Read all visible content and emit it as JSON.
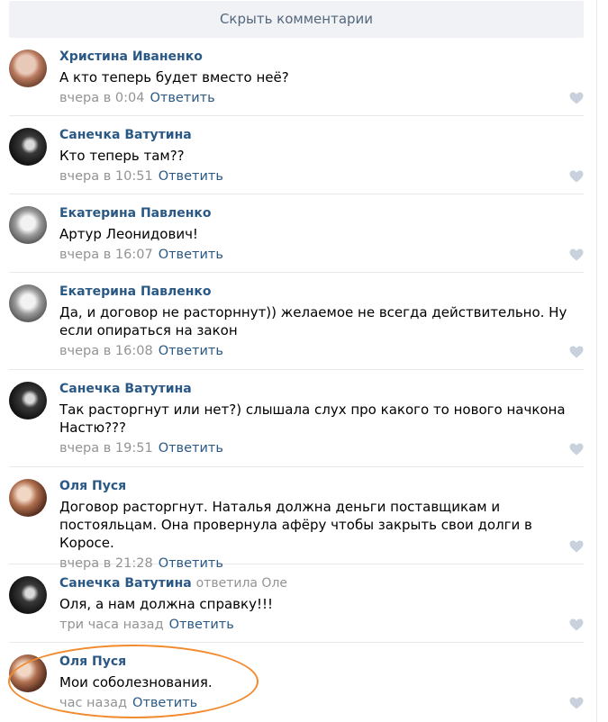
{
  "hide_comments_label": "Скрыть комментарии",
  "colors": {
    "link": "#2a5885",
    "meta": "#939393",
    "highlight": "#f28a2e",
    "button_bg": "#f0f2f5"
  },
  "comments": [
    {
      "author": "Христина Иваненко",
      "reply_to": "",
      "text": "А кто теперь будет вместо неё?",
      "time": "вчера в 0:04",
      "reply_label": "Ответить",
      "avatar_icon": "user-avatar-photo"
    },
    {
      "author": "Санечка Ватутина",
      "reply_to": "",
      "text": "Кто теперь там??",
      "time": "вчера в 10:51",
      "reply_label": "Ответить",
      "avatar_icon": "user-avatar-photo"
    },
    {
      "author": "Екатерина Павленко",
      "reply_to": "",
      "text": "Артур Леонидович!",
      "time": "вчера в 16:07",
      "reply_label": "Ответить",
      "avatar_icon": "user-avatar-photo"
    },
    {
      "author": "Екатерина Павленко",
      "reply_to": "",
      "text": "Да, и договор не расторннут)) желаемое не всегда действительно. Ну если опираться на закон",
      "time": "вчера в 16:08",
      "reply_label": "Ответить",
      "avatar_icon": "user-avatar-photo"
    },
    {
      "author": "Санечка Ватутина",
      "reply_to": "",
      "text": "Так расторгнут или нет?) слышала слух про какого то нового начкона Настю???",
      "time": "вчера в 19:51",
      "reply_label": "Ответить",
      "avatar_icon": "user-avatar-photo"
    },
    {
      "author": "Оля Пуся",
      "reply_to": "",
      "text": "Договор расторгнут. Наталья должна деньги поставщикам и постояльцам. Она провернула афёру чтобы закрыть свои долги в Коросе.",
      "time": "вчера в 21:28",
      "reply_label": "Ответить",
      "avatar_icon": "user-avatar-photo"
    },
    {
      "author": "Санечка Ватутина",
      "reply_to": "ответила Оле",
      "text": "Оля, а нам должна справку!!!",
      "time": "три часа назад",
      "reply_label": "Ответить",
      "avatar_icon": "user-avatar-photo"
    },
    {
      "author": "Оля Пуся",
      "reply_to": "",
      "text": "Мои соболезнования.",
      "time": "час назад",
      "reply_label": "Ответить",
      "avatar_icon": "user-avatar-photo"
    }
  ]
}
